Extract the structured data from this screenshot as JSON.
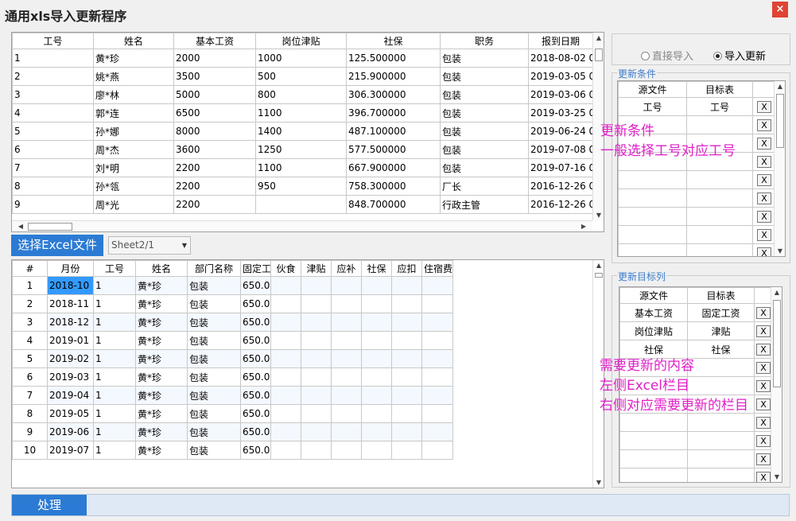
{
  "window": {
    "title": "通用xls导入更新程序",
    "close": "×"
  },
  "upper_table": {
    "headers": [
      "工号",
      "姓名",
      "基本工资",
      "岗位津贴",
      "社保",
      "职务",
      "报到日期"
    ],
    "rows": [
      [
        "1",
        "黄*珍",
        "2000",
        "1000",
        "125.500000",
        "包装",
        "2018-08-02 0"
      ],
      [
        "2",
        "姚*燕",
        "3500",
        "500",
        "215.900000",
        "包装",
        "2019-03-05 0"
      ],
      [
        "3",
        "廖*林",
        "5000",
        "800",
        "306.300000",
        "包装",
        "2019-03-06 0"
      ],
      [
        "4",
        "郭*连",
        "6500",
        "1100",
        "396.700000",
        "包装",
        "2019-03-25 0"
      ],
      [
        "5",
        "孙*娜",
        "8000",
        "1400",
        "487.100000",
        "包装",
        "2019-06-24 0"
      ],
      [
        "6",
        "周*杰",
        "3600",
        "1250",
        "577.500000",
        "包装",
        "2019-07-08 0"
      ],
      [
        "7",
        "刘*明",
        "2200",
        "1100",
        "667.900000",
        "包装",
        "2019-07-16 0"
      ],
      [
        "8",
        "孙*瓴",
        "2200",
        "950",
        "758.300000",
        "厂长",
        "2016-12-26 0"
      ],
      [
        "9",
        "周*光",
        "2200",
        "",
        "848.700000",
        "行政主管",
        "2016-12-26 0"
      ]
    ]
  },
  "toolbar": {
    "excel_button": "选择Excel文件",
    "sheet_value": "Sheet2/1"
  },
  "lower_table": {
    "headers": [
      "#",
      "月份",
      "工号",
      "姓名",
      "部门名称",
      "固定工资",
      "伙食",
      "津贴",
      "应补",
      "社保",
      "应扣",
      "住宿费"
    ],
    "rows": [
      [
        "1",
        "2018-10",
        "1",
        "黄*珍",
        "包装",
        "650.00",
        "",
        "",
        "",
        "",
        "",
        ""
      ],
      [
        "2",
        "2018-11",
        "1",
        "黄*珍",
        "包装",
        "650.00",
        "",
        "",
        "",
        "",
        "",
        ""
      ],
      [
        "3",
        "2018-12",
        "1",
        "黄*珍",
        "包装",
        "650.00",
        "",
        "",
        "",
        "",
        "",
        ""
      ],
      [
        "4",
        "2019-01",
        "1",
        "黄*珍",
        "包装",
        "650.00",
        "",
        "",
        "",
        "",
        "",
        ""
      ],
      [
        "5",
        "2019-02",
        "1",
        "黄*珍",
        "包装",
        "650.00",
        "",
        "",
        "",
        "",
        "",
        ""
      ],
      [
        "6",
        "2019-03",
        "1",
        "黄*珍",
        "包装",
        "650.00",
        "",
        "",
        "",
        "",
        "",
        ""
      ],
      [
        "7",
        "2019-04",
        "1",
        "黄*珍",
        "包装",
        "650.00",
        "",
        "",
        "",
        "",
        "",
        ""
      ],
      [
        "8",
        "2019-05",
        "1",
        "黄*珍",
        "包装",
        "650.00",
        "",
        "",
        "",
        "",
        "",
        ""
      ],
      [
        "9",
        "2019-06",
        "1",
        "黄*珍",
        "包装",
        "650.00",
        "",
        "",
        "",
        "",
        "",
        ""
      ],
      [
        "10",
        "2019-07",
        "1",
        "黄*珍",
        "包装",
        "650.00",
        "",
        "",
        "",
        "",
        "",
        ""
      ]
    ]
  },
  "mode": {
    "direct_import": "直接导入",
    "import_update": "导入更新",
    "selected": "导入更新"
  },
  "update_conditions": {
    "label": "更新条件",
    "headers": [
      "源文件",
      "目标表"
    ],
    "rows": [
      [
        "工号",
        "工号"
      ],
      [
        "",
        ""
      ],
      [
        "",
        ""
      ],
      [
        "",
        ""
      ],
      [
        "",
        ""
      ],
      [
        "",
        ""
      ],
      [
        "",
        ""
      ],
      [
        "",
        ""
      ],
      [
        "",
        ""
      ]
    ],
    "remove": "X"
  },
  "update_targets": {
    "label": "更新目标列",
    "headers": [
      "源文件",
      "目标表"
    ],
    "rows": [
      [
        "基本工资",
        "固定工资"
      ],
      [
        "岗位津贴",
        "津贴"
      ],
      [
        "社保",
        "社保"
      ],
      [
        "",
        ""
      ],
      [
        "",
        ""
      ],
      [
        "",
        ""
      ],
      [
        "",
        ""
      ],
      [
        "",
        ""
      ],
      [
        "",
        ""
      ],
      [
        "",
        ""
      ]
    ],
    "remove": "X"
  },
  "annotations": {
    "conditions": [
      "更新条件",
      "一般选择工号对应工号"
    ],
    "targets": [
      "需要更新的内容",
      "左侧Excel栏目",
      "右侧对应需要更新的栏目"
    ]
  },
  "actions": {
    "process": "处理"
  },
  "colors": {
    "accent": "#2b7bd4",
    "annotation": "#e020c8",
    "group_label": "#3d7cc9",
    "selection": "#3399ff"
  }
}
